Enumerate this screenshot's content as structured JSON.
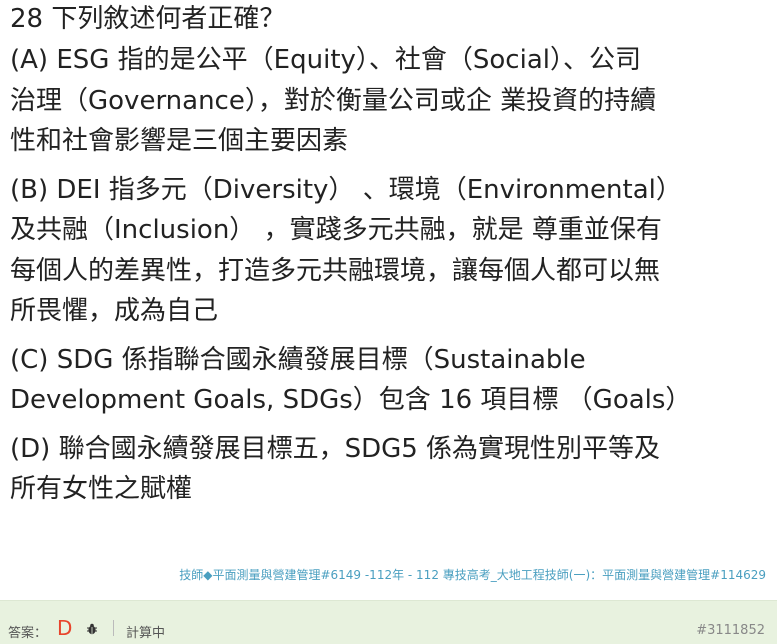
{
  "question": {
    "title": "28 下列敘述何者正確？",
    "options": [
      {
        "lines": [
          "(A) ESG 指的是公平（Equity）、社會（Social）、公司",
          "治理（Governance），對於衡量公司或企 業投資的持續",
          "性和社會影響是三個主要因素"
        ]
      },
      {
        "lines": [
          "(B) DEI 指多元（Diversity） 、環境（Environmental）",
          "及共融（Inclusion） ，實踐多元共融，就是 尊重並保有",
          "每個人的差異性，打造多元共融環境，讓每個人都可以無",
          "所畏懼，成為自己"
        ]
      },
      {
        "lines": [
          "(C) SDG 係指聯合國永續發展目標（Sustainable",
          "Development Goals, SDGs）包含 16 項目標 （Goals）"
        ]
      },
      {
        "lines": [
          "(D) 聯合國永續發展目標五，SDG5 係為實現性別平等及",
          "所有女性之賦權"
        ]
      }
    ]
  },
  "tags": "技師◆平面測量與營建管理#6149 -112年 - 112 專技高考_大地工程技師(一)：平面測量與營建管理#114629",
  "footer": {
    "answer_label": "答案：",
    "answer_value": "D",
    "bug_icon": "bug-icon",
    "calc_status": "計算中",
    "question_id": "#3111852"
  },
  "colors": {
    "tags": "#4a9fc0",
    "footer_bg": "#e8f2df",
    "answer": "#e8452c"
  }
}
